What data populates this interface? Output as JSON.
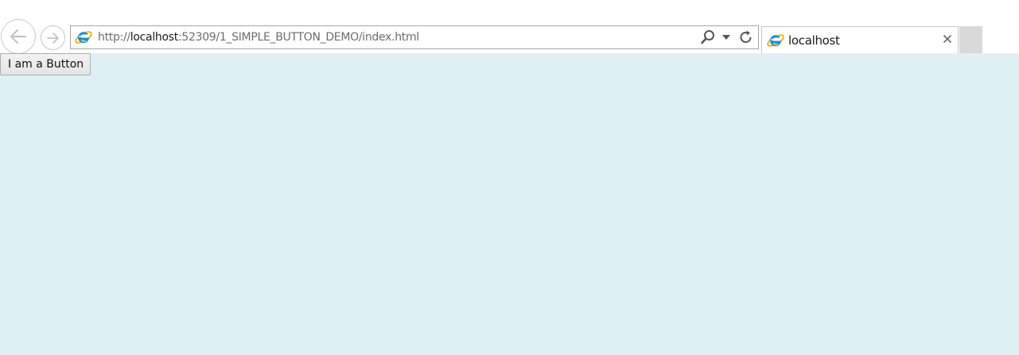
{
  "browser": {
    "address_bar": {
      "url_prefix": "http://",
      "url_host": "localhost",
      "url_suffix": ":52309/1_SIMPLE_BUTTON_DEMO/index.html"
    },
    "tab": {
      "title": "localhost"
    },
    "icons": {
      "back": "back-arrow-icon",
      "forward": "forward-arrow-icon",
      "site": "internet-explorer-icon",
      "search": "search-icon",
      "dropdown": "chevron-down-icon",
      "refresh": "refresh-icon",
      "close": "close-icon"
    }
  },
  "page": {
    "background_color": "#dff0f4",
    "button_label": "I am a Button"
  }
}
